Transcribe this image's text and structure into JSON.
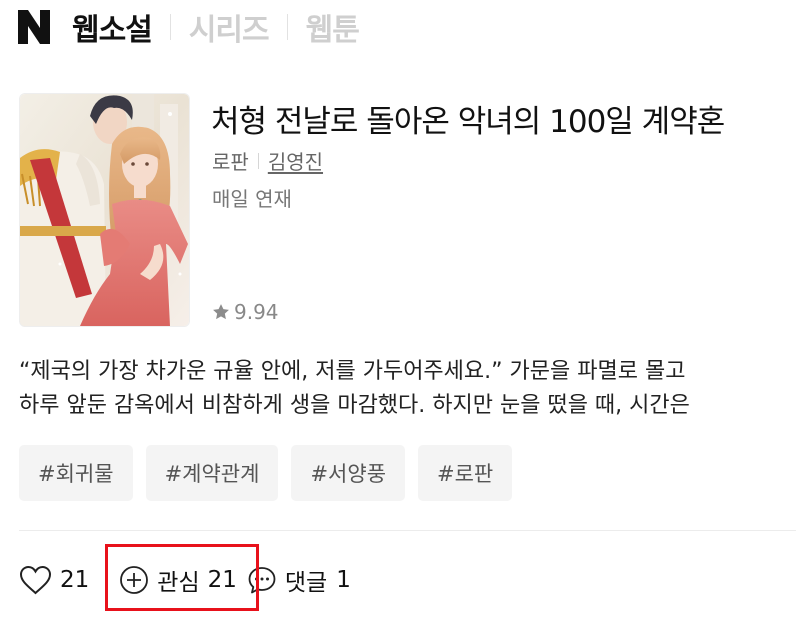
{
  "header": {
    "logo_icon": "naver-n-logo",
    "nav": [
      {
        "label": "웹소설",
        "active": true
      },
      {
        "label": "시리즈",
        "active": false
      },
      {
        "label": "웹툰",
        "active": false
      }
    ]
  },
  "work": {
    "title": "처형 전날로 돌아온 악녀의 100일 계약혼",
    "genre": "로판",
    "author": "김영진",
    "schedule": "매일 연재",
    "rating": "9.94",
    "rating_icon": "star-icon",
    "synopsis_lines": [
      "“제국의 가장 차가운 규율 안에, 저를 가두어주세요.” 가문을 파멸로 몰고",
      "하루 앞둔 감옥에서 비참하게 생을 마감했다. 하지만 눈을 떴을 때, 시간은"
    ],
    "tags": [
      "#회귀물",
      "#계약관계",
      "#서양풍",
      "#로판"
    ]
  },
  "actions": {
    "like": {
      "icon": "heart-icon",
      "count": "21"
    },
    "interest": {
      "icon": "plus-circle-icon",
      "label": "관심",
      "count": "21"
    },
    "comment": {
      "icon": "comment-bubble-icon",
      "label": "댓글",
      "count": "1"
    }
  },
  "colors": {
    "highlight": "#e8111b",
    "nav_inactive": "#cfcfcf",
    "tag_bg": "#f4f4f4"
  }
}
